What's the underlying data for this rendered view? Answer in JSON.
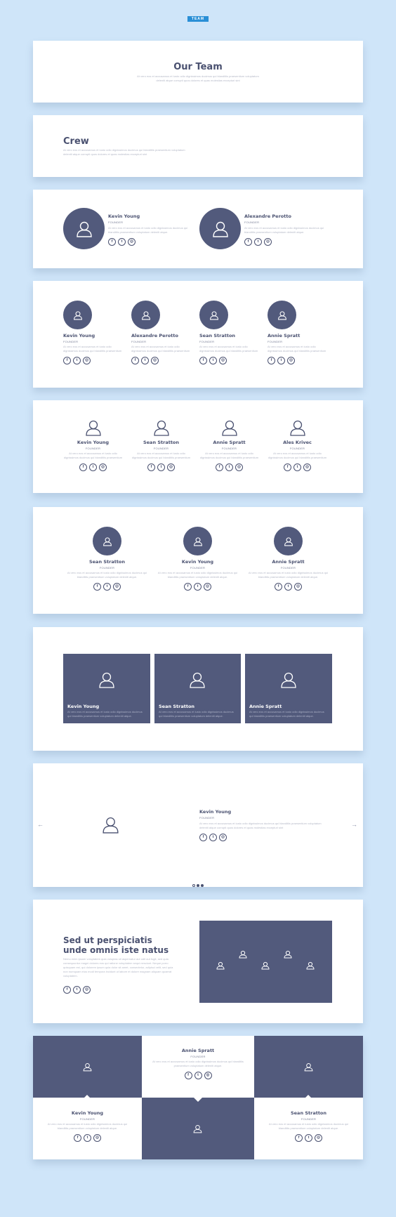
{
  "badge": "TEAM",
  "lorem_short": "At vero eos et accusamus et iusto odio dignissimos ducimus qui blanditiis praesentium voluptatum deleniti atque corrupti quos dolores et quas molestias excepturi sint",
  "lorem_card": "At vero eos et accusamus et iusto odio dignissimos ducimus qui blanditiis praesentium voluptatum deleniti atque.",
  "lorem_long": "Nemo enim ipsam voluptatem quia voluptas sit aspernatur aut odit aut fugit, sed quia consequuntur magni dolores eos qui ratione voluptatem sequi nesciunt. Neque porro quisquam est, qui dolorem ipsum quia dolor sit amet, consectetur, adipisci velit, sed quia non numquam eius modi tempora incidunt ut labore et dolore magnam aliquam quaerat voluptatem.",
  "section1": {
    "title": "Our Team"
  },
  "section2": {
    "title": "Crew"
  },
  "role": "FOUNDER",
  "social": {
    "facebook": "f",
    "twitter": "t",
    "instagram": "◎"
  },
  "section3": {
    "members": [
      "Kevin Young",
      "Alexandre Perotto"
    ]
  },
  "section4": {
    "members": [
      "Kevin Young",
      "Alexandre Perotto",
      "Sean Stratton",
      "Annie Spratt"
    ]
  },
  "section5": {
    "members": [
      "Kevin Young",
      "Sean Stratton",
      "Annie Spratt",
      "Ales Krivec"
    ]
  },
  "section6": {
    "members": [
      "Sean Stratton",
      "Kevin Young",
      "Annie Spratt"
    ]
  },
  "section7": {
    "members": [
      "Kevin Young",
      "Sean Stratton",
      "Annie Spratt"
    ]
  },
  "section8": {
    "member": "Kevin Young",
    "prev": "←",
    "next": "→"
  },
  "section9": {
    "title_line1": "Sed ut perspiciatis",
    "title_line2": "unde omnis iste natus"
  },
  "section10": {
    "top_member": "Annie Spratt",
    "bottom_left": "Kevin Young",
    "bottom_right": "Sean Stratton"
  }
}
